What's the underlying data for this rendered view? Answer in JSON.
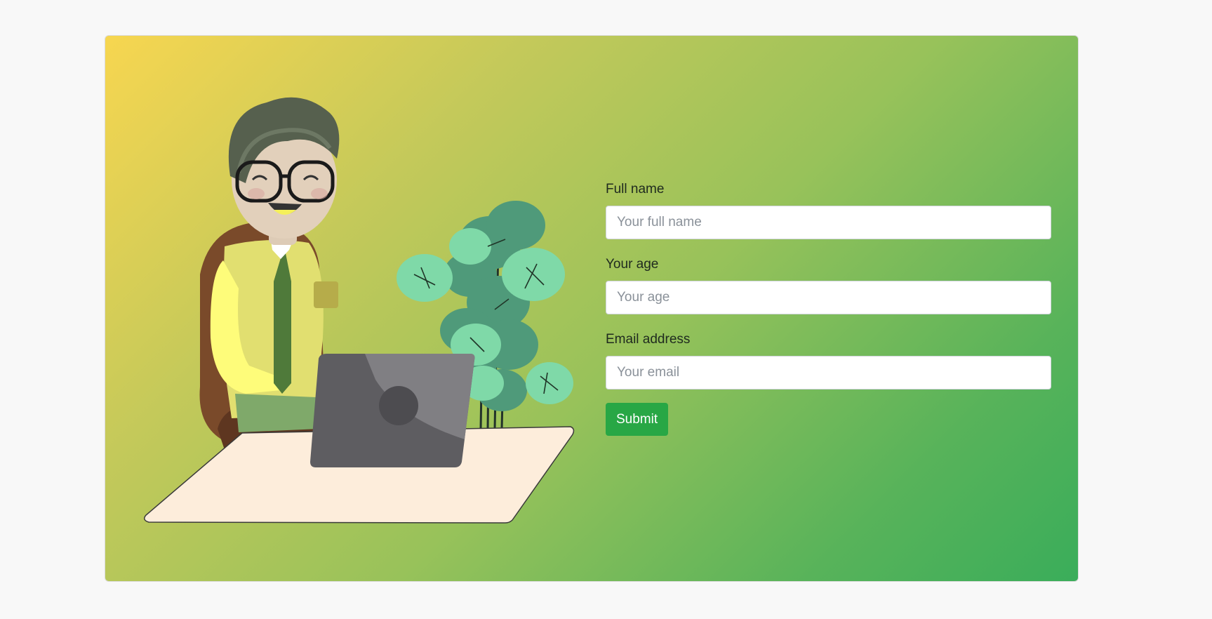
{
  "form": {
    "full_name": {
      "label": "Full name",
      "placeholder": "Your full name",
      "value": ""
    },
    "age": {
      "label": "Your age",
      "placeholder": "Your age",
      "value": ""
    },
    "email": {
      "label": "Email address",
      "placeholder": "Your email",
      "value": ""
    },
    "submit_label": "Submit"
  },
  "colors": {
    "gradient_start": "#f7d650",
    "gradient_end": "#3aad5a",
    "submit_button": "#28a745"
  },
  "illustration": {
    "subject": "smiling-man-with-glasses-at-laptop",
    "elements": [
      "man-figure",
      "office-chair",
      "laptop",
      "desk",
      "monstera-plant"
    ]
  }
}
